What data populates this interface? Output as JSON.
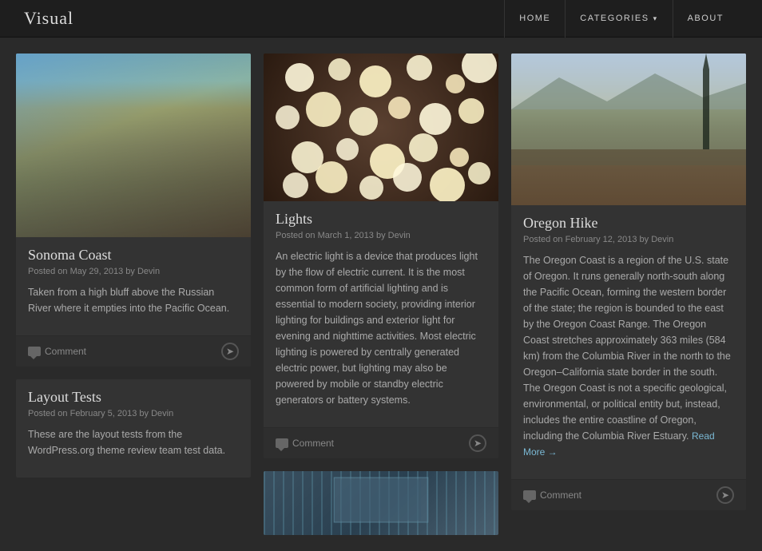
{
  "header": {
    "site_title": "Visual",
    "nav": [
      {
        "label": "Home",
        "id": "home"
      },
      {
        "label": "Categories",
        "id": "categories",
        "has_dropdown": true
      },
      {
        "label": "About",
        "id": "about"
      }
    ]
  },
  "posts": {
    "col1": [
      {
        "id": "sonoma-coast",
        "title": "Sonoma Coast",
        "meta": "Posted on May 29, 2013 by Devin",
        "excerpt": "Taken from a high bluff above the Russian River where it empties into the Pacific Ocean.",
        "has_image": true,
        "comment_label": "Comment",
        "read_more": null
      },
      {
        "id": "layout-tests",
        "title": "Layout Tests",
        "meta": "Posted on February 5, 2013 by Devin",
        "excerpt": "These are the layout tests from the WordPress.org theme review team test data.",
        "has_image": false,
        "comment_label": null,
        "read_more": null
      }
    ],
    "col2": [
      {
        "id": "lights",
        "title": "Lights",
        "meta": "Posted on March 1, 2013 by Devin",
        "excerpt": "An electric light is a device that produces light by the flow of electric current. It is the most common form of artificial lighting and is essential to modern society, providing interior lighting for buildings and exterior light for evening and nighttime activities. Most electric lighting is powered by centrally generated electric power, but lighting may also be powered by mobile or standby electric generators or battery systems.",
        "has_image": true,
        "comment_label": "Comment",
        "read_more": null
      },
      {
        "id": "bottom-post",
        "title": null,
        "meta": null,
        "excerpt": null,
        "has_image": true,
        "comment_label": null,
        "read_more": null
      }
    ],
    "col3": [
      {
        "id": "oregon-hike",
        "title": "Oregon Hike",
        "meta": "Posted on February 12, 2013 by Devin",
        "excerpt": "The Oregon Coast is a region of the U.S. state of Oregon. It runs generally north-south along the Pacific Ocean, forming the western border of the state; the region is bounded to the east by the Oregon Coast Range. The Oregon Coast stretches approximately 363 miles (584 km) from the Columbia River in the north to the Oregon–California state border in the south. The Oregon Coast is not a specific geological, environmental, or political entity but, instead, includes the entire coastline of Oregon, including the Columbia River Estuary.",
        "has_image": true,
        "comment_label": "Comment",
        "read_more": "Read More →"
      }
    ]
  },
  "colors": {
    "accent": "#7ab8d4",
    "background": "#2a2a2a",
    "card_bg": "#333",
    "header_bg": "#1e1e1e",
    "text_primary": "#ddd",
    "text_secondary": "#aaa",
    "text_meta": "#888"
  }
}
